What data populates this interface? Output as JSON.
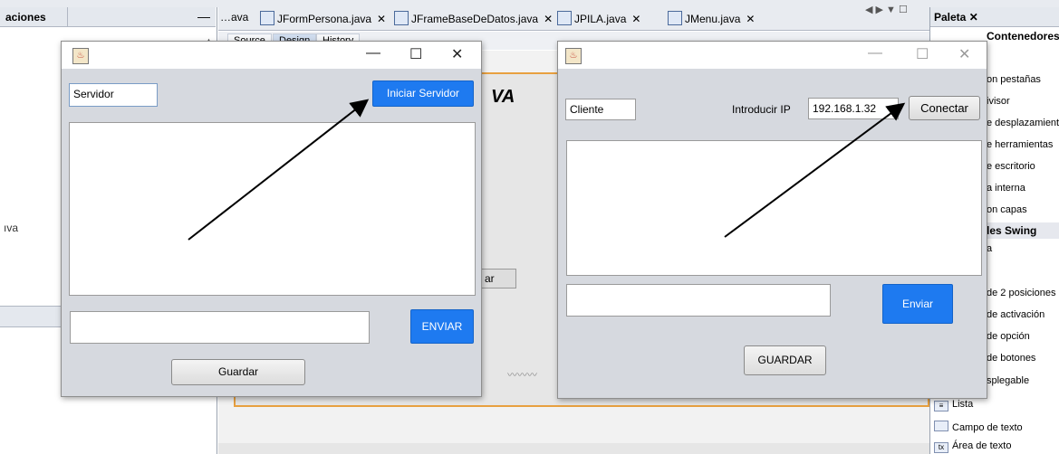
{
  "ide": {
    "left_panel_title": "aciones",
    "left_panel_minimize": "—",
    "left_tree_item": "ıva",
    "left_tree_scroll": "▲",
    "editor_tabs": [
      {
        "label": "…ava",
        "closable": false,
        "icon": false
      },
      {
        "label": "JFormPersona.java",
        "closable": true,
        "icon": true
      },
      {
        "label": "JFrameBaseDeDatos.java",
        "closable": true,
        "icon": true
      },
      {
        "label": "JPILA.java",
        "closable": true,
        "icon": true
      },
      {
        "label": "JMenu.java",
        "closable": true,
        "icon": true
      }
    ],
    "tab_close_glyph": "✕",
    "tab_nav": "◀ ▶ ▼ ☐",
    "editor_modes": [
      "Source",
      "Design",
      "History"
    ],
    "design_ghost_title": "VA",
    "design_ghost_button": "ar",
    "design_ghost_wave": "〰〰〰",
    "palette": {
      "tab_label": "Paleta ✕",
      "section_containers": "Contenedores Swing",
      "container_items": [
        "on pestañas",
        "ivisor",
        "e desplazamiento",
        "e herramientas",
        "e escritorio",
        "a interna",
        "on capas"
      ],
      "section_controls": "les Swing",
      "control_first": "a",
      "control_items": [
        "de 2 posiciones",
        "de activación",
        "de opción",
        "de botones",
        "splegable"
      ],
      "bottom_items": [
        {
          "label": "Lista",
          "icon": "list-icon",
          "glyph": "≡"
        },
        {
          "label": "Campo de texto",
          "icon": "textfield-icon",
          "glyph": ""
        },
        {
          "label": "Área de texto",
          "icon": "textarea-icon",
          "glyph": "tx"
        }
      ]
    }
  },
  "server_window": {
    "icon_glyph": "♨",
    "controls": {
      "minimize": "—",
      "maximize": "☐",
      "close": "✕"
    },
    "name_field": "Servidor",
    "start_button": "Iniciar Servidor",
    "message_field": "",
    "send_button": "ENVIAR",
    "save_button": "Guardar"
  },
  "client_window": {
    "icon_glyph": "♨",
    "controls": {
      "minimize": "—",
      "maximize": "☐",
      "close": "✕"
    },
    "name_field": "Cliente",
    "ip_label": "Introducir IP",
    "ip_field": "192.168.1.32",
    "connect_button": "Conectar",
    "message_field": "",
    "send_button": "Enviar",
    "save_button": "GUARDAR"
  },
  "colors": {
    "accent_blue": "#1e7af0",
    "dialog_bg": "#d6d9df",
    "palette_highlight": "#e8a040"
  }
}
